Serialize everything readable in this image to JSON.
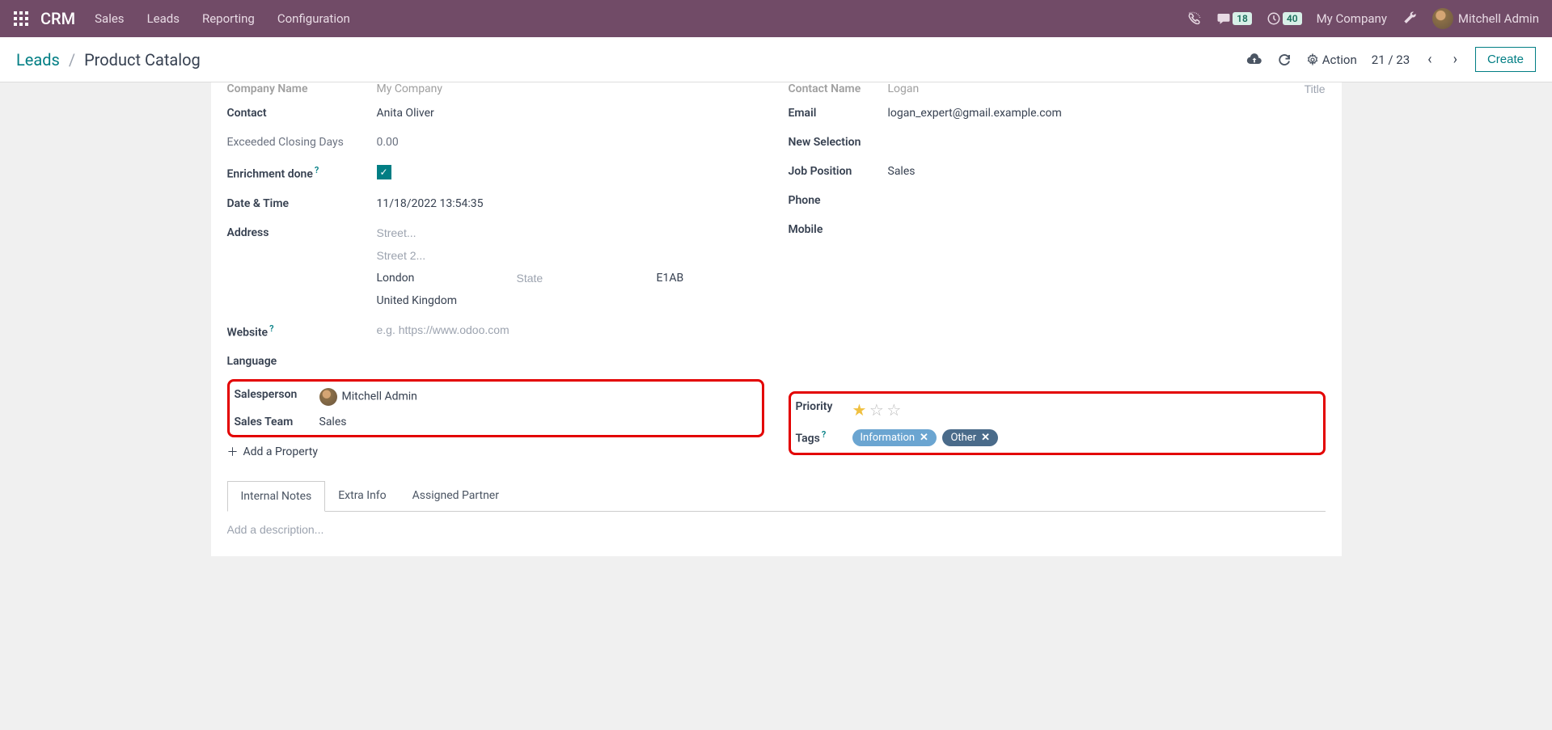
{
  "brand": "CRM",
  "nav": {
    "items": [
      "Sales",
      "Leads",
      "Reporting",
      "Configuration"
    ]
  },
  "badges": {
    "messages": "18",
    "activities": "40"
  },
  "company": "My Company",
  "user": "Mitchell Admin",
  "breadcrumb": {
    "parent": "Leads",
    "current": "Product Catalog"
  },
  "action_label": "Action",
  "pager": {
    "current": "21",
    "total": "23"
  },
  "create_label": "Create",
  "left": {
    "company_name_label": "Company Name",
    "company_name_value": "My Company",
    "contact_label": "Contact",
    "contact_value": "Anita Oliver",
    "exceeded_label": "Exceeded Closing Days",
    "exceeded_value": "0.00",
    "enrichment_label": "Enrichment done",
    "datetime_label": "Date & Time",
    "datetime_value": "11/18/2022 13:54:35",
    "address_label": "Address",
    "street_ph": "Street...",
    "street2_ph": "Street 2...",
    "city_value": "London",
    "state_ph": "State",
    "zip_value": "E1AB",
    "country_value": "United Kingdom",
    "website_label": "Website",
    "website_ph": "e.g. https://www.odoo.com",
    "language_label": "Language",
    "salesperson_label": "Salesperson",
    "salesperson_value": "Mitchell Admin",
    "salesteam_label": "Sales Team",
    "salesteam_value": "Sales",
    "add_property": "Add a Property"
  },
  "right": {
    "contact_name_label": "Contact Name",
    "contact_name_value": "Logan",
    "title_ph": "Title",
    "email_label": "Email",
    "email_value": "logan_expert@gmail.example.com",
    "new_selection_label": "New Selection",
    "job_position_label": "Job Position",
    "job_position_value": "Sales",
    "phone_label": "Phone",
    "mobile_label": "Mobile",
    "priority_label": "Priority",
    "tags_label": "Tags",
    "tag1": "Information",
    "tag2": "Other"
  },
  "tabs": {
    "t1": "Internal Notes",
    "t2": "Extra Info",
    "t3": "Assigned Partner"
  },
  "notes_ph": "Add a description..."
}
